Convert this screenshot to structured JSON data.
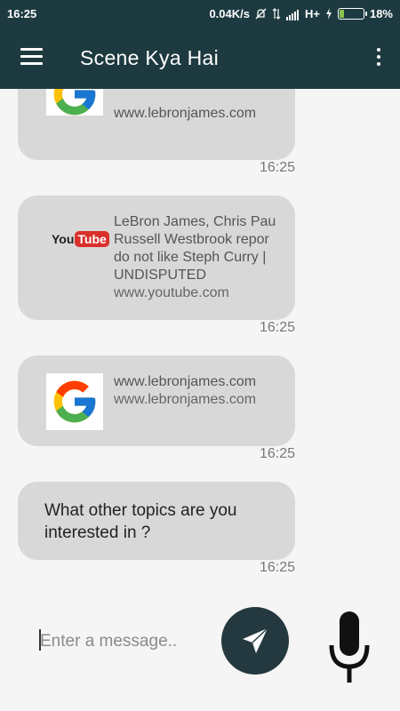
{
  "status_bar": {
    "time": "16:25",
    "network_speed": "0.04K/s",
    "network_type": "H+",
    "battery": "18%",
    "battery_level": 0.18
  },
  "app_bar": {
    "title": "Scene Kya Hai",
    "menu_icon": "hamburger-menu-icon",
    "overflow_icon": "more-vertical-icon"
  },
  "messages": [
    {
      "type": "link",
      "icon": "google-g-icon",
      "title": "",
      "domain": "www.lebronjames.com",
      "time": "16:25"
    },
    {
      "type": "link",
      "icon": "youtube-icon",
      "logo_you": "You",
      "logo_tube": "Tube",
      "title_lines": [
        "LeBron James, Chris Pau",
        "Russell Westbrook repor",
        "do not like Steph Curry |",
        "UNDISPUTED"
      ],
      "domain": "www.youtube.com",
      "time": "16:25"
    },
    {
      "type": "link",
      "icon": "google-g-icon",
      "title": "www.lebronjames.com",
      "domain": "www.lebronjames.com",
      "time": "16:25"
    },
    {
      "type": "text",
      "text_lines": [
        "What other topics are you",
        "interested in ?"
      ],
      "time": "16:25"
    }
  ],
  "input": {
    "placeholder": "Enter a message..",
    "value": ""
  },
  "colors": {
    "app_bar": "#1d3a40",
    "bubble": "#d8d8d8",
    "send_button": "#24393f"
  },
  "icons": {
    "send": "send-icon",
    "mic": "microphone-icon"
  }
}
